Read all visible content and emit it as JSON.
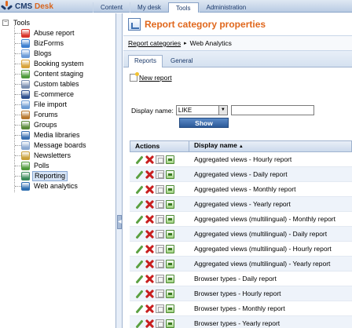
{
  "app": {
    "logo_text": "CMS",
    "logo_text_accent": "Desk"
  },
  "top_tabs": [
    {
      "label": "Content",
      "active": false
    },
    {
      "label": "My desk",
      "active": false
    },
    {
      "label": "Tools",
      "active": true
    },
    {
      "label": "Administration",
      "active": false
    }
  ],
  "tree": {
    "root_label": "Tools",
    "toggle": "−",
    "items": [
      {
        "label": "Abuse report",
        "icon": "abuse-report-icon",
        "color": "#d9342b"
      },
      {
        "label": "BizForms",
        "icon": "bizforms-icon",
        "color": "#3c7fd0"
      },
      {
        "label": "Blogs",
        "icon": "blogs-icon",
        "color": "#6a9ad8"
      },
      {
        "label": "Booking system",
        "icon": "booking-system-icon",
        "color": "#d8a23a"
      },
      {
        "label": "Content staging",
        "icon": "content-staging-icon",
        "color": "#4f9a3c"
      },
      {
        "label": "Custom tables",
        "icon": "custom-tables-icon",
        "color": "#7a8fb0"
      },
      {
        "label": "E-commerce",
        "icon": "e-commerce-icon",
        "color": "#2f4f8f"
      },
      {
        "label": "File import",
        "icon": "file-import-icon",
        "color": "#6c9bd2"
      },
      {
        "label": "Forums",
        "icon": "forums-icon",
        "color": "#b8772e"
      },
      {
        "label": "Groups",
        "icon": "groups-icon",
        "color": "#5a8a3a"
      },
      {
        "label": "Media libraries",
        "icon": "media-libraries-icon",
        "color": "#3a6fb0"
      },
      {
        "label": "Message boards",
        "icon": "message-boards-icon",
        "color": "#8aa8d0"
      },
      {
        "label": "Newsletters",
        "icon": "newsletters-icon",
        "color": "#c9a03a"
      },
      {
        "label": "Polls",
        "icon": "polls-icon",
        "color": "#4f9a3c"
      },
      {
        "label": "Reporting",
        "icon": "reporting-icon",
        "color": "#3a8a5a",
        "selected": true
      },
      {
        "label": "Web analytics",
        "icon": "web-analytics-icon",
        "color": "#2f6fb0"
      }
    ]
  },
  "main": {
    "page_title": "Report category properties",
    "breadcrumb": {
      "link": "Report categories",
      "separator": "▸",
      "current": "Web Analytics"
    },
    "subtabs": [
      {
        "label": "Reports",
        "active": true
      },
      {
        "label": "General",
        "active": false
      }
    ],
    "new_report_label": "New report",
    "filter": {
      "label": "Display name:",
      "operator": "LIKE",
      "value": "",
      "show_label": "Show"
    },
    "grid": {
      "col_actions": "Actions",
      "col_name": "Display name",
      "sort_indicator": "▲",
      "rows": [
        "Aggregated views - Hourly report",
        "Aggregated views - Daily report",
        "Aggregated views - Monthly report",
        "Aggregated views - Yearly report",
        "Aggregated views (multilingual) - Monthly report",
        "Aggregated views (multilingual) - Daily report",
        "Aggregated views (multilingual) - Hourly report",
        "Aggregated views (multilingual) - Yearly report",
        "Browser types - Daily report",
        "Browser types - Hourly report",
        "Browser types - Monthly report",
        "Browser types - Yearly report"
      ]
    }
  }
}
